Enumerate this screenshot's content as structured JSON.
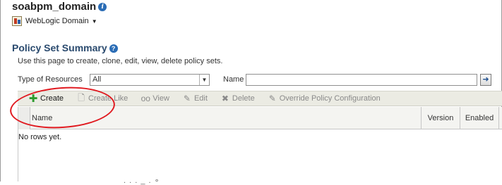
{
  "header": {
    "domain_title": "soabpm_domain",
    "domain_menu_label": "WebLogic Domain"
  },
  "section": {
    "title": "Policy Set Summary",
    "instructions": "Use this page to create, clone, edit, view, delete policy sets."
  },
  "filters": {
    "type_label": "Type of Resources",
    "type_value": "All",
    "name_label": "Name",
    "name_value": ""
  },
  "toolbar": {
    "create": "Create",
    "create_like": "Create Like",
    "view": "View",
    "edit": "Edit",
    "delete": "Delete",
    "override": "Override Policy Configuration"
  },
  "table": {
    "columns": [
      "Name",
      "Version",
      "Enabled"
    ],
    "empty_message": "No rows yet."
  },
  "colors": {
    "section_title": "#2a4a6e",
    "annotation": "#e0191f",
    "create_icon": "#2e9b2e"
  },
  "icons": [
    "info-icon",
    "help-icon",
    "domain-icon",
    "go-arrow-icon",
    "plus-icon",
    "document-icon",
    "glasses-icon",
    "pencil-icon",
    "x-icon"
  ]
}
